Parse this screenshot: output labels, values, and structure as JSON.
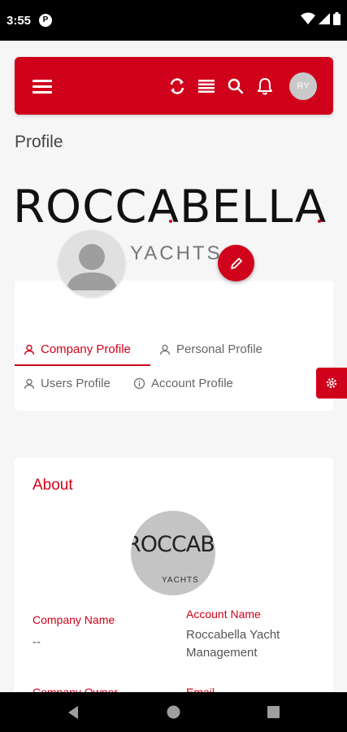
{
  "status_bar": {
    "time": "3:55",
    "app_icon": "P"
  },
  "header": {
    "menu_icon": "hamburger-menu-icon",
    "refresh_icon": "refresh-icon",
    "list_icon": "list-icon",
    "search_icon": "search-icon",
    "bell_icon": "bell-icon",
    "avatar_initials": "RY"
  },
  "page": {
    "title": "Profile"
  },
  "brand": {
    "name": "ROCCABELLA",
    "subtitle": "YACHTS"
  },
  "tabs": [
    {
      "label": "Company Profile",
      "icon": "user-icon",
      "active": true
    },
    {
      "label": "Personal Profile",
      "icon": "user-icon",
      "active": false
    },
    {
      "label": "Users Profile",
      "icon": "user-icon",
      "active": false
    },
    {
      "label": "Account Profile",
      "icon": "info-icon",
      "active": false
    }
  ],
  "about": {
    "title": "About",
    "logo_text_main": "ROCCABELLA",
    "logo_text_sub": "YACHTS",
    "fields": [
      {
        "label": "Company Name",
        "value": "--"
      },
      {
        "label": "Account Name",
        "value": "Roccabella Yacht Management"
      },
      {
        "label": "Company Owner",
        "value": ""
      },
      {
        "label": "Email",
        "value": ""
      }
    ]
  },
  "colors": {
    "brand_red": "#d0021b",
    "background": "#f6f6f6",
    "card": "#ffffff"
  }
}
